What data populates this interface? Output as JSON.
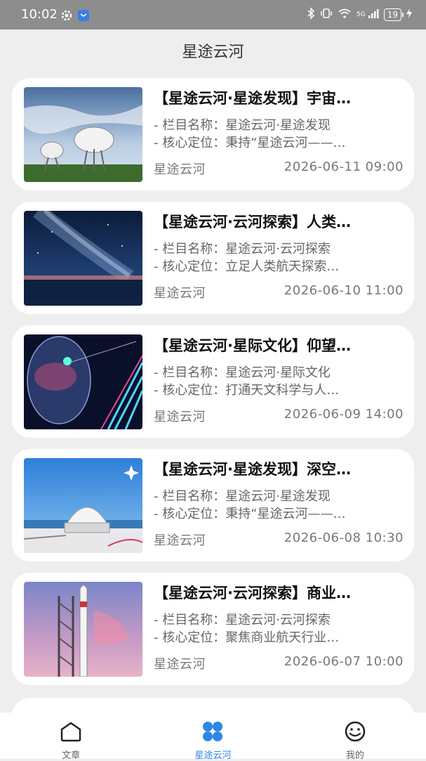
{
  "status_bar": {
    "time": "10:02",
    "left_icons": [
      "settings-gear-icon",
      "app-notification-icon"
    ],
    "right_icons": [
      "bluetooth-icon",
      "vibrate-icon",
      "wifi-icon",
      "signal-icon",
      "charging-icon"
    ],
    "network_label": "5G",
    "battery_level": "19"
  },
  "header": {
    "title": "星途云河"
  },
  "articles": [
    {
      "title": "【星途云河·星途发现】宇宙…",
      "line1": "- 栏目名称：星途云河·星途发现",
      "line2": "- 核心定位：秉持“星途云河——…",
      "source": "星途云河",
      "datetime": "2026-06-11 09:00",
      "image": "radio-telescope-photo"
    },
    {
      "title": "【星途云河·云河探索】人类…",
      "line1": "- 栏目名称：星途云河·云河探索",
      "line2": "- 核心定位：立足人类航天探索…",
      "source": "星途云河",
      "datetime": "2026-06-10 11:00",
      "image": "milky-way-photo"
    },
    {
      "title": "【星途云河·星际文化】仰望…",
      "line1": "- 栏目名称：星途云河·星际文化",
      "line2": "- 核心定位：打通天文科学与人…",
      "source": "星途云河",
      "datetime": "2026-06-09 14:00",
      "image": "galaxy-lens-illustration"
    },
    {
      "title": "【星途云河·星途发现】深空…",
      "line1": "- 栏目名称：星途云河·星途发现",
      "line2": "- 核心定位：秉持“星途云河——…",
      "source": "星途云河",
      "datetime": "2026-06-08 10:30",
      "image": "observatory-dome-photo"
    },
    {
      "title": "【星途云河·云河探索】商业…",
      "line1": "- 栏目名称：星途云河·云河探索",
      "line2": "- 核心定位：聚焦商业航天行业…",
      "source": "星途云河",
      "datetime": "2026-06-07 10:00",
      "image": "rocket-launch-photo"
    }
  ],
  "nav": {
    "items": [
      {
        "label": "文章",
        "icon": "home-icon"
      },
      {
        "label": "星途云河",
        "icon": "grid-icon",
        "active": true
      },
      {
        "label": "我的",
        "icon": "smiley-icon"
      }
    ]
  },
  "colors": {
    "accent": "#2e86e6",
    "background": "#eeeeee",
    "status_bar": "#8d8d8d"
  }
}
